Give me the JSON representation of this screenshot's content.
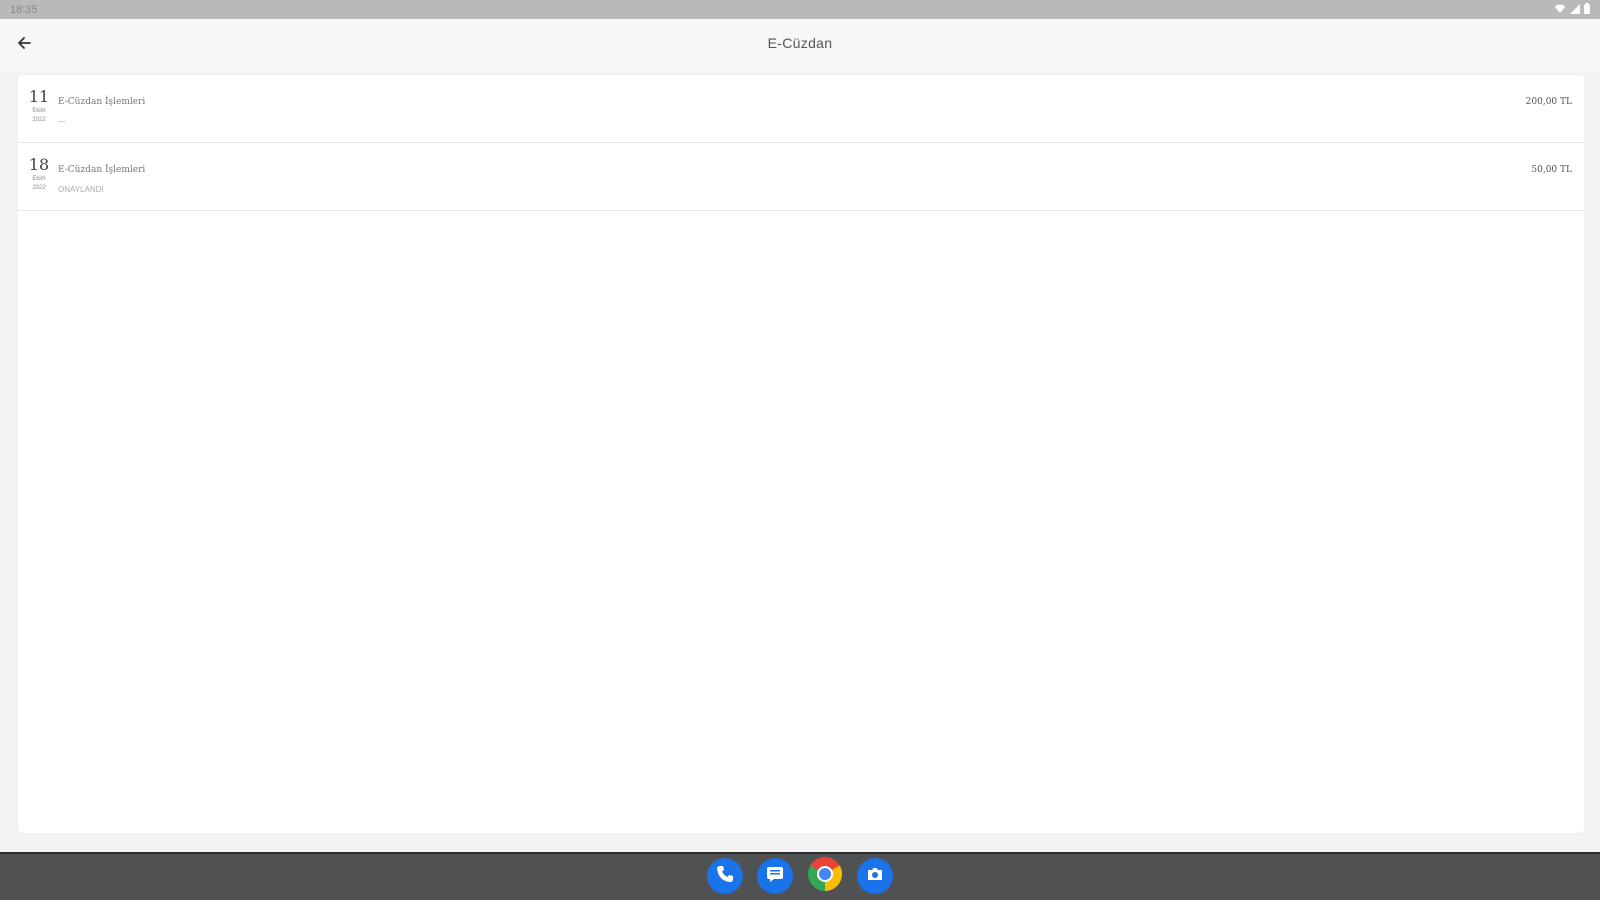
{
  "status_bar": {
    "time": "18:35",
    "icons": [
      "wifi-icon",
      "signal-icon",
      "battery-icon"
    ]
  },
  "app_bar": {
    "title": "E-Cüzdan",
    "back_icon": "arrow-left-icon"
  },
  "transactions": [
    {
      "day": "11",
      "month": "Ekim",
      "year": "2022",
      "title": "E-Cüzdan İşlemleri",
      "subtitle": "—",
      "amount": "200,00 TL"
    },
    {
      "day": "18",
      "month": "Ekim",
      "year": "2022",
      "title": "E-Cüzdan İşlemleri",
      "subtitle": "ONAYLANDI",
      "amount": "50,00 TL"
    }
  ],
  "dock": [
    {
      "name": "phone",
      "icon": "phone-icon",
      "color": "#1a73e8"
    },
    {
      "name": "messages",
      "icon": "message-icon",
      "color": "#1a73e8"
    },
    {
      "name": "chrome",
      "icon": "chrome-icon",
      "color": "#34a853"
    },
    {
      "name": "camera",
      "icon": "camera-icon",
      "color": "#1a73e8"
    }
  ],
  "colors": {
    "status_bar": "#b9b9b9",
    "app_bar": "#f7f7f7",
    "background": "#f3f3f3",
    "nav_bar": "#505152",
    "accent_blue": "#1a73e8"
  }
}
